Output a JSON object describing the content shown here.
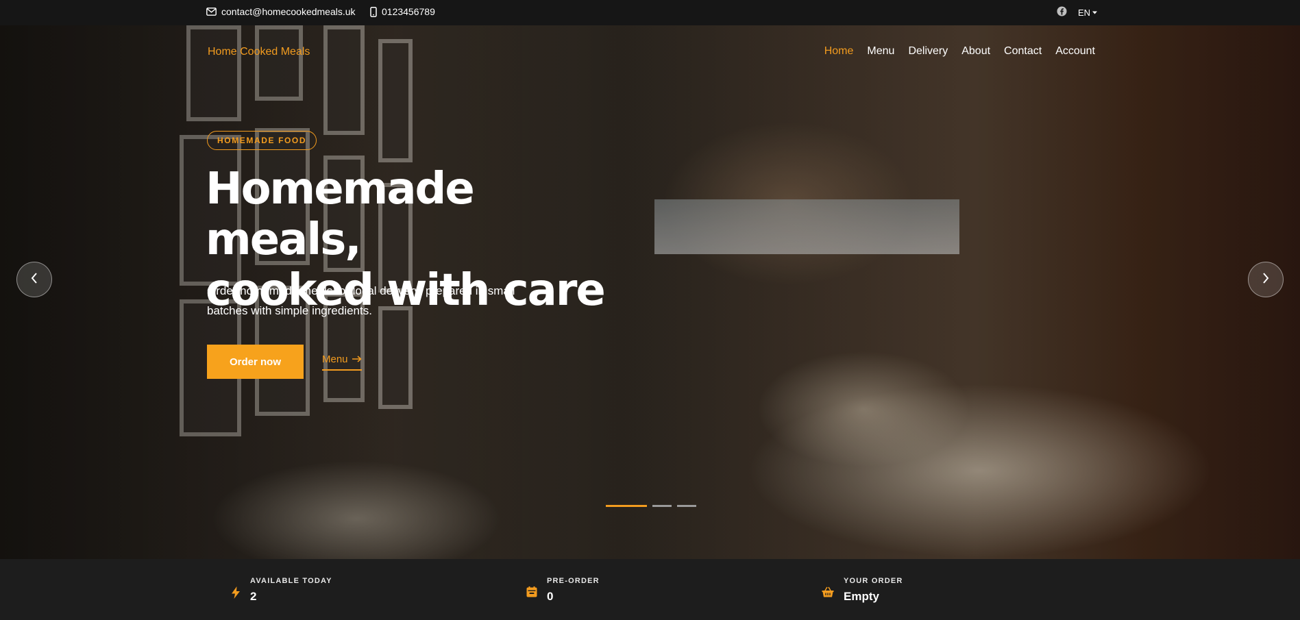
{
  "topbar": {
    "email": "contact@homecookedmeals.uk",
    "phone": "0123456789",
    "language": "EN",
    "icons": {
      "email": "envelope-icon",
      "phone": "mobile-phone-icon",
      "social": "facebook-icon"
    }
  },
  "brand": {
    "name": "Home Cooked Meals"
  },
  "nav": {
    "items": [
      "Home",
      "Menu",
      "Delivery",
      "About",
      "Contact",
      "Account"
    ],
    "active": "Home"
  },
  "hero": {
    "badge": "HOMEMADE FOOD",
    "title_line1": "Homemade meals,",
    "title_line2": "cooked with care",
    "subtitle": "Order homemade meals for local delivery, prepared in small batches with simple ingredients.",
    "primary_button": "Order now",
    "secondary_link": "Menu",
    "slides": {
      "total": 3,
      "active": 1
    }
  },
  "stats": [
    {
      "label": "AVAILABLE TODAY",
      "value": "2",
      "icon": "lightning-icon"
    },
    {
      "label": "PRE-ORDER",
      "value": "0",
      "icon": "calendar-icon"
    },
    {
      "label": "YOUR ORDER",
      "value": "Empty",
      "icon": "basket-icon"
    }
  ],
  "colors": {
    "accent": "#f39c1f",
    "topbar": "#161616",
    "statsbar": "#1d1d1d"
  }
}
